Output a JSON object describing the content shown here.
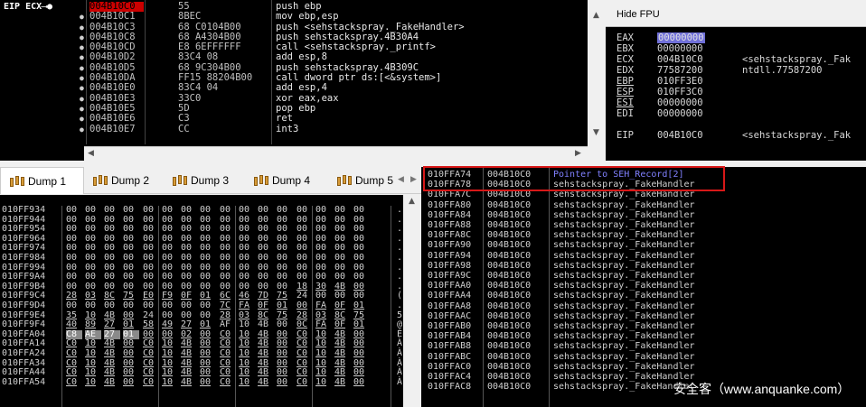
{
  "disasm": {
    "eip_label": "EIP ECX",
    "eip_arrow": "⟶●",
    "rows": [
      {
        "addr": "004B10C0",
        "bytes": "55",
        "instr": "push ebp",
        "current": true
      },
      {
        "addr": "004B10C1",
        "bytes": "8BEC",
        "instr": "mov ebp,esp"
      },
      {
        "addr": "004B10C3",
        "bytes": "68 C0104B00",
        "instr": "push <sehstackspray._FakeHandler>"
      },
      {
        "addr": "004B10C8",
        "bytes": "68 A4304B00",
        "instr": "push sehstackspray.4B30A4"
      },
      {
        "addr": "004B10CD",
        "bytes": "E8 6EFFFFFF",
        "instr": "call <sehstackspray._printf>"
      },
      {
        "addr": "004B10D2",
        "bytes": "83C4 08",
        "instr": "add esp,8"
      },
      {
        "addr": "004B10D5",
        "bytes": "68 9C304B00",
        "instr": "push sehstackspray.4B309C"
      },
      {
        "addr": "004B10DA",
        "bytes": "FF15 88204B00",
        "instr": "call dword ptr ds:[<&system>]"
      },
      {
        "addr": "004B10E0",
        "bytes": "83C4 04",
        "instr": "add esp,4"
      },
      {
        "addr": "004B10E3",
        "bytes": "33C0",
        "instr": "xor eax,eax"
      },
      {
        "addr": "004B10E5",
        "bytes": "5D",
        "instr": "pop ebp"
      },
      {
        "addr": "004B10E6",
        "bytes": "C3",
        "instr": "ret"
      },
      {
        "addr": "004B10E7",
        "bytes": "CC",
        "instr": "int3"
      }
    ]
  },
  "registers": {
    "hide_fpu_label": "Hide FPU",
    "rows": [
      {
        "name": "EAX",
        "value": "00000000",
        "comment": "",
        "hl": true
      },
      {
        "name": "EBX",
        "value": "00000000",
        "comment": ""
      },
      {
        "name": "ECX",
        "value": "004B10C0",
        "comment": "<sehstackspray._Fak"
      },
      {
        "name": "EDX",
        "value": "77587200",
        "comment": "ntdll.77587200"
      },
      {
        "name": "EBP",
        "value": "010FF3E0",
        "comment": "",
        "u": true
      },
      {
        "name": "ESP",
        "value": "010FF3C0",
        "comment": "",
        "u": true
      },
      {
        "name": "ESI",
        "value": "00000000",
        "comment": "",
        "u": true
      },
      {
        "name": "EDI",
        "value": "00000000",
        "comment": ""
      },
      {
        "name": "EIP",
        "value": "004B10C0",
        "comment": "<sehstackspray._Fak",
        "gap": true
      }
    ]
  },
  "dump_tabs": [
    {
      "label": "Dump 1",
      "active": true
    },
    {
      "label": "Dump 2"
    },
    {
      "label": "Dump 3"
    },
    {
      "label": "Dump 4"
    },
    {
      "label": "Dump 5"
    }
  ],
  "hexdump": {
    "rows": [
      {
        "addr": "010FF934",
        "bytes": [
          "00",
          "00",
          "00",
          "00",
          "00",
          "00",
          "00",
          "00",
          "00",
          "00",
          "00",
          "00",
          "00",
          "00",
          "00",
          "00"
        ],
        "ascii": "."
      },
      {
        "addr": "010FF944",
        "bytes": [
          "00",
          "00",
          "00",
          "00",
          "00",
          "00",
          "00",
          "00",
          "00",
          "00",
          "00",
          "00",
          "00",
          "00",
          "00",
          "00"
        ],
        "ascii": "."
      },
      {
        "addr": "010FF954",
        "bytes": [
          "00",
          "00",
          "00",
          "00",
          "00",
          "00",
          "00",
          "00",
          "00",
          "00",
          "00",
          "00",
          "00",
          "00",
          "00",
          "00"
        ],
        "ascii": "."
      },
      {
        "addr": "010FF964",
        "bytes": [
          "00",
          "00",
          "00",
          "00",
          "00",
          "00",
          "00",
          "00",
          "00",
          "00",
          "00",
          "00",
          "00",
          "00",
          "00",
          "00"
        ],
        "ascii": "."
      },
      {
        "addr": "010FF974",
        "bytes": [
          "00",
          "00",
          "00",
          "00",
          "00",
          "00",
          "00",
          "00",
          "00",
          "00",
          "00",
          "00",
          "00",
          "00",
          "00",
          "00"
        ],
        "ascii": "."
      },
      {
        "addr": "010FF984",
        "bytes": [
          "00",
          "00",
          "00",
          "00",
          "00",
          "00",
          "00",
          "00",
          "00",
          "00",
          "00",
          "00",
          "00",
          "00",
          "00",
          "00"
        ],
        "ascii": "."
      },
      {
        "addr": "010FF994",
        "bytes": [
          "00",
          "00",
          "00",
          "00",
          "00",
          "00",
          "00",
          "00",
          "00",
          "00",
          "00",
          "00",
          "00",
          "00",
          "00",
          "00"
        ],
        "ascii": "."
      },
      {
        "addr": "010FF9A4",
        "bytes": [
          "00",
          "00",
          "00",
          "00",
          "00",
          "00",
          "00",
          "00",
          "00",
          "00",
          "00",
          "00",
          "00",
          "00",
          "00",
          "00"
        ],
        "ascii": "."
      },
      {
        "addr": "010FF9B4",
        "bytes": [
          "00",
          "00",
          "00",
          "00",
          "00",
          "00",
          "00",
          "00",
          "00",
          "00",
          "00",
          "00",
          "18",
          "30",
          "4B",
          "00"
        ],
        "ascii": ".",
        "u": [
          12,
          13,
          14,
          15
        ]
      },
      {
        "addr": "010FF9C4",
        "bytes": [
          "28",
          "03",
          "8C",
          "75",
          "E0",
          "F9",
          "0F",
          "01",
          "6C",
          "46",
          "7D",
          "75",
          "24",
          "00",
          "00",
          "00"
        ],
        "ascii": "(",
        "u": [
          0,
          1,
          2,
          3,
          4,
          5,
          6,
          7,
          8,
          9,
          10,
          11
        ]
      },
      {
        "addr": "010FF9D4",
        "bytes": [
          "00",
          "00",
          "00",
          "00",
          "00",
          "00",
          "00",
          "00",
          "7C",
          "FA",
          "0F",
          "01",
          "00",
          "FA",
          "0F",
          "01"
        ],
        "ascii": ".",
        "u": [
          8,
          9,
          10,
          11,
          12,
          13,
          14,
          15
        ]
      },
      {
        "addr": "010FF9E4",
        "bytes": [
          "35",
          "10",
          "4B",
          "00",
          "24",
          "00",
          "00",
          "00",
          "28",
          "03",
          "8C",
          "75",
          "28",
          "03",
          "8C",
          "75"
        ],
        "ascii": "5",
        "u": [
          0,
          1,
          2,
          3,
          8,
          9,
          10,
          11,
          12,
          13,
          14,
          15
        ]
      },
      {
        "addr": "010FF9F4",
        "bytes": [
          "40",
          "89",
          "27",
          "01",
          "58",
          "49",
          "27",
          "01",
          "AF",
          "10",
          "4B",
          "00",
          "0C",
          "FA",
          "0F",
          "01"
        ],
        "ascii": "@",
        "u": [
          0,
          1,
          2,
          3,
          4,
          5,
          6,
          7,
          12,
          13,
          14,
          15
        ]
      },
      {
        "addr": "010FFA04",
        "bytes": [
          "C8",
          "AE",
          "27",
          "01",
          "00",
          "00",
          "02",
          "00",
          "C0",
          "10",
          "4B",
          "00",
          "C0",
          "10",
          "4B",
          "00"
        ],
        "ascii": "È",
        "sel": [
          0,
          1,
          2,
          3
        ],
        "u": [
          4,
          5,
          6,
          7,
          8,
          9,
          10,
          11,
          12,
          13,
          14,
          15
        ]
      },
      {
        "addr": "010FFA14",
        "bytes": [
          "C0",
          "10",
          "4B",
          "00",
          "C0",
          "10",
          "4B",
          "00",
          "C0",
          "10",
          "4B",
          "00",
          "C0",
          "10",
          "4B",
          "00"
        ],
        "ascii": "À",
        "u": "all"
      },
      {
        "addr": "010FFA24",
        "bytes": [
          "C0",
          "10",
          "4B",
          "00",
          "C0",
          "10",
          "4B",
          "00",
          "C0",
          "10",
          "4B",
          "00",
          "C0",
          "10",
          "4B",
          "00"
        ],
        "ascii": "À",
        "u": "all"
      },
      {
        "addr": "010FFA34",
        "bytes": [
          "C0",
          "10",
          "4B",
          "00",
          "C0",
          "10",
          "4B",
          "00",
          "C0",
          "10",
          "4B",
          "00",
          "C0",
          "10",
          "4B",
          "00"
        ],
        "ascii": "À",
        "u": "all"
      },
      {
        "addr": "010FFA44",
        "bytes": [
          "C0",
          "10",
          "4B",
          "00",
          "C0",
          "10",
          "4B",
          "00",
          "C0",
          "10",
          "4B",
          "00",
          "C0",
          "10",
          "4B",
          "00"
        ],
        "ascii": "À",
        "u": "all"
      },
      {
        "addr": "010FFA54",
        "bytes": [
          "C0",
          "10",
          "4B",
          "00",
          "C0",
          "10",
          "4B",
          "00",
          "C0",
          "10",
          "4B",
          "00",
          "C0",
          "10",
          "4B",
          "00"
        ],
        "ascii": "À",
        "u": "all"
      }
    ]
  },
  "stack": {
    "rows": [
      {
        "addr": "010FFA74",
        "value": "004B10C0",
        "comment": "Pointer to SEH_Record[2]",
        "ptr": true
      },
      {
        "addr": "010FFA78",
        "value": "004B10C0",
        "comment": "sehstackspray._FakeHandler"
      },
      {
        "addr": "010FFA7C",
        "value": "004B10C0",
        "comment": "sehstackspray._FakeHandler"
      },
      {
        "addr": "010FFA80",
        "value": "004B10C0",
        "comment": "sehstackspray._FakeHandler"
      },
      {
        "addr": "010FFA84",
        "value": "004B10C0",
        "comment": "sehstackspray._FakeHandler"
      },
      {
        "addr": "010FFA88",
        "value": "004B10C0",
        "comment": "sehstackspray._FakeHandler"
      },
      {
        "addr": "010FFA8C",
        "value": "004B10C0",
        "comment": "sehstackspray._FakeHandler"
      },
      {
        "addr": "010FFA90",
        "value": "004B10C0",
        "comment": "sehstackspray._FakeHandler"
      },
      {
        "addr": "010FFA94",
        "value": "004B10C0",
        "comment": "sehstackspray._FakeHandler"
      },
      {
        "addr": "010FFA98",
        "value": "004B10C0",
        "comment": "sehstackspray._FakeHandler"
      },
      {
        "addr": "010FFA9C",
        "value": "004B10C0",
        "comment": "sehstackspray._FakeHandler"
      },
      {
        "addr": "010FFAA0",
        "value": "004B10C0",
        "comment": "sehstackspray._FakeHandler"
      },
      {
        "addr": "010FFAA4",
        "value": "004B10C0",
        "comment": "sehstackspray._FakeHandler"
      },
      {
        "addr": "010FFAA8",
        "value": "004B10C0",
        "comment": "sehstackspray._FakeHandler"
      },
      {
        "addr": "010FFAAC",
        "value": "004B10C0",
        "comment": "sehstackspray._FakeHandler"
      },
      {
        "addr": "010FFAB0",
        "value": "004B10C0",
        "comment": "sehstackspray._FakeHandler"
      },
      {
        "addr": "010FFAB4",
        "value": "004B10C0",
        "comment": "sehstackspray._FakeHandler"
      },
      {
        "addr": "010FFAB8",
        "value": "004B10C0",
        "comment": "sehstackspray._FakeHandler"
      },
      {
        "addr": "010FFABC",
        "value": "004B10C0",
        "comment": "sehstackspray._FakeHandler"
      },
      {
        "addr": "010FFAC0",
        "value": "004B10C0",
        "comment": "sehstackspray._FakeHandler"
      },
      {
        "addr": "010FFAC4",
        "value": "004B10C0",
        "comment": "sehstackspray._FakeHandler"
      },
      {
        "addr": "010FFAC8",
        "value": "004B10C0",
        "comment": "sehstackspray._FakeHandler"
      }
    ]
  },
  "watermark": "安全客（www.anquanke.com）",
  "colors": {
    "eip_highlight": "#cc0000",
    "reg_highlight": "#7070d8",
    "pointer_text": "#8080ff",
    "seh_box": "#d81818"
  }
}
